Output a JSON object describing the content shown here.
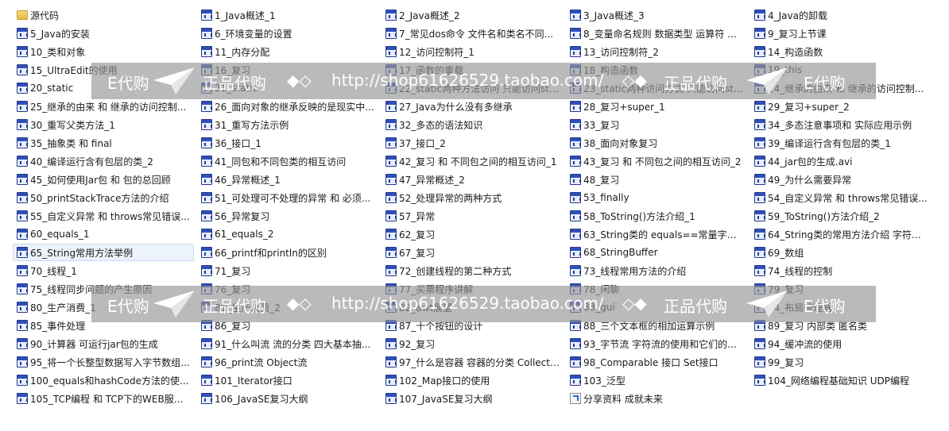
{
  "files": [
    {
      "name": "源代码",
      "type": "folder"
    },
    {
      "name": "1_Java概述_1",
      "type": "video"
    },
    {
      "name": "2_Java概述_2",
      "type": "video"
    },
    {
      "name": "3_Java概述_3",
      "type": "video"
    },
    {
      "name": "4_Java的卸载",
      "type": "video"
    },
    {
      "name": "5_Java的安装",
      "type": "video"
    },
    {
      "name": "6_环境变量的设置",
      "type": "video"
    },
    {
      "name": "7_常见dos命令 文件名和类名不同...",
      "type": "video"
    },
    {
      "name": "8_变量命名规则 数据类型 运算符 格...",
      "type": "video"
    },
    {
      "name": "9_复习上节课",
      "type": "video"
    },
    {
      "name": "10_类和对象",
      "type": "video"
    },
    {
      "name": "11_内存分配",
      "type": "video"
    },
    {
      "name": "12_访问控制符_1",
      "type": "video"
    },
    {
      "name": "13_访问控制符_2",
      "type": "video"
    },
    {
      "name": "14_构造函数",
      "type": "video"
    },
    {
      "name": "15_UltraEdit的使用",
      "type": "video"
    },
    {
      "name": "16_复习",
      "type": "video"
    },
    {
      "name": "17_函数的重载",
      "type": "video"
    },
    {
      "name": "18_构造函数",
      "type": "video"
    },
    {
      "name": "19_this",
      "type": "video"
    },
    {
      "name": "20_static",
      "type": "video"
    },
    {
      "name": "21_static",
      "type": "video"
    },
    {
      "name": "22_static两种方法访问 只能访问static...",
      "type": "video"
    },
    {
      "name": "23_static两种访问方式 只能访问static...",
      "type": "video"
    },
    {
      "name": "24_继承的由来 和 继承的访问控制...",
      "type": "video"
    },
    {
      "name": "25_继承的由来 和 继承的访问控制...",
      "type": "video"
    },
    {
      "name": "26_面向对象的继承反映的是现实中...",
      "type": "video"
    },
    {
      "name": "27_Java为什么没有多继承",
      "type": "video"
    },
    {
      "name": "28_复习+super_1",
      "type": "video"
    },
    {
      "name": "29_复习+super_2",
      "type": "video"
    },
    {
      "name": "30_重写父类方法_1",
      "type": "video"
    },
    {
      "name": "31_重写方法示例",
      "type": "video"
    },
    {
      "name": "32_多态的语法知识",
      "type": "video"
    },
    {
      "name": "33_复习",
      "type": "video"
    },
    {
      "name": "34_多态注意事项和 实际应用示例",
      "type": "video"
    },
    {
      "name": "35_抽象类 和 final",
      "type": "video"
    },
    {
      "name": "36_接口_1",
      "type": "video"
    },
    {
      "name": "37_接口_2",
      "type": "video"
    },
    {
      "name": "38_面向对象复习",
      "type": "video"
    },
    {
      "name": "39_编译运行含有包层的类_1",
      "type": "video"
    },
    {
      "name": "40_编译运行含有包层的类_2",
      "type": "video"
    },
    {
      "name": "41_同包和不同包类的相互访问",
      "type": "video"
    },
    {
      "name": "42_复习 和 不同包之间的相互访问_1",
      "type": "video"
    },
    {
      "name": "43_复习 和 不同包之间的相互访问_2",
      "type": "video"
    },
    {
      "name": "44_jar包的生成.avi",
      "type": "video"
    },
    {
      "name": "45_如何使用Jar包 和 包的总回顾",
      "type": "video"
    },
    {
      "name": "46_异常概述_1",
      "type": "video"
    },
    {
      "name": "47_异常概述_2",
      "type": "video"
    },
    {
      "name": "48_复习",
      "type": "video"
    },
    {
      "name": "49_为什么需要异常",
      "type": "video"
    },
    {
      "name": "50_printStackTrace方法的介绍",
      "type": "video"
    },
    {
      "name": "51_可处理可不处理的异常 和 必须...",
      "type": "video"
    },
    {
      "name": "52_处理异常的两种方式",
      "type": "video"
    },
    {
      "name": "53_finally",
      "type": "video"
    },
    {
      "name": "54_自定义异常 和 throws常见错误...",
      "type": "video"
    },
    {
      "name": "55_自定义异常 和 throws常见错误...",
      "type": "video"
    },
    {
      "name": "56_异常复习",
      "type": "video"
    },
    {
      "name": "57_异常",
      "type": "video"
    },
    {
      "name": "58_ToString()方法介绍_1",
      "type": "video"
    },
    {
      "name": "59_ToString()方法介绍_2",
      "type": "video"
    },
    {
      "name": "60_equals_1",
      "type": "video"
    },
    {
      "name": "61_equals_2",
      "type": "video"
    },
    {
      "name": "62_复习",
      "type": "video"
    },
    {
      "name": "63_String类的 equals==常量字符...",
      "type": "video"
    },
    {
      "name": "64_String类的常用方法介绍 字符串...",
      "type": "video"
    },
    {
      "name": "65_String常用方法举例",
      "type": "video",
      "selected": true
    },
    {
      "name": "66_printf和println的区别",
      "type": "video"
    },
    {
      "name": "67_复习",
      "type": "video"
    },
    {
      "name": "68_StringBuffer",
      "type": "video"
    },
    {
      "name": "69_数组",
      "type": "video"
    },
    {
      "name": "70_线程_1",
      "type": "video"
    },
    {
      "name": "71_复习",
      "type": "video"
    },
    {
      "name": "72_创建线程的第二种方式",
      "type": "video"
    },
    {
      "name": "73_线程常用方法的介绍",
      "type": "video"
    },
    {
      "name": "74_线程的控制",
      "type": "video"
    },
    {
      "name": "75_线程同步问题的产生原因",
      "type": "video"
    },
    {
      "name": "76_复习",
      "type": "video"
    },
    {
      "name": "77_买票程序讲解",
      "type": "video"
    },
    {
      "name": "78_闲聊",
      "type": "video"
    },
    {
      "name": "79_复习",
      "type": "video"
    },
    {
      "name": "80_生产消费_1",
      "type": "video"
    },
    {
      "name": "81_生产消费_2",
      "type": "video"
    },
    {
      "name": "82_awt展望",
      "type": "video"
    },
    {
      "name": "83_gui",
      "type": "video"
    },
    {
      "name": "84_布局管理器",
      "type": "video"
    },
    {
      "name": "85_事件处理",
      "type": "video"
    },
    {
      "name": "86_复习",
      "type": "video"
    },
    {
      "name": "87_十个按钮的设计",
      "type": "video"
    },
    {
      "name": "88_三个文本框的相加运算示例",
      "type": "video"
    },
    {
      "name": "89_复习 内部类 匿名类",
      "type": "video"
    },
    {
      "name": "90_计算器 可运行jar包的生成",
      "type": "video"
    },
    {
      "name": "91_什么叫流 流的分类 四大基本抽...",
      "type": "video"
    },
    {
      "name": "92_复习",
      "type": "video"
    },
    {
      "name": "93_字节流 字符流的使用和它们的区...",
      "type": "video"
    },
    {
      "name": "94_缓冲流的使用",
      "type": "video"
    },
    {
      "name": "95_将一个长整型数据写入字节数组...",
      "type": "video"
    },
    {
      "name": "96_print流 Object流",
      "type": "video"
    },
    {
      "name": "97_什么是容器 容器的分类 Collecti...",
      "type": "video"
    },
    {
      "name": "98_Comparable 接口 Set接口",
      "type": "video"
    },
    {
      "name": "99_复习",
      "type": "video"
    },
    {
      "name": "100_equals和hashCode方法的使...",
      "type": "video"
    },
    {
      "name": "101_Iterator接口",
      "type": "video"
    },
    {
      "name": "102_Map接口的使用",
      "type": "video"
    },
    {
      "name": "103_泛型",
      "type": "video"
    },
    {
      "name": "104_网络编程基础知识 UDP编程",
      "type": "video"
    },
    {
      "name": "105_TCP编程 和 TCP下的WEB服务...",
      "type": "video"
    },
    {
      "name": "106_JavaSE复习大纲",
      "type": "video"
    },
    {
      "name": "107_JavaSE复习大纲",
      "type": "video"
    },
    {
      "name": "分享资料 成就未来",
      "type": "shortcut"
    }
  ],
  "watermark": {
    "brand": "E代购",
    "slogan": "正品代购",
    "symbols": "◆◇",
    "symbols_alt": "◇◆",
    "url": "http://shop61626529.taobao.com/"
  },
  "colors": {
    "selection_bg": "#edf3fb",
    "selection_border": "#c9daf1",
    "video_icon_blue": "#2f4fb8",
    "folder_yellow": "#e7b93e",
    "watermark_band": "#969696"
  }
}
